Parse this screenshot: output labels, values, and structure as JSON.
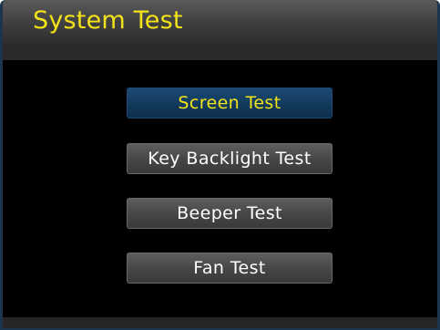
{
  "window": {
    "title": "System Test"
  },
  "menu": {
    "items": [
      {
        "label": "Screen Test",
        "selected": true
      },
      {
        "label": "Key Backlight Test",
        "selected": false
      },
      {
        "label": "Beeper Test",
        "selected": false
      },
      {
        "label": "Fan Test",
        "selected": false
      }
    ]
  },
  "colors": {
    "title_text": "#f2e21a",
    "selected_background": "#123a5c",
    "selected_text": "#f2e21a",
    "button_text": "#ffffff",
    "screen_background": "#000000"
  }
}
